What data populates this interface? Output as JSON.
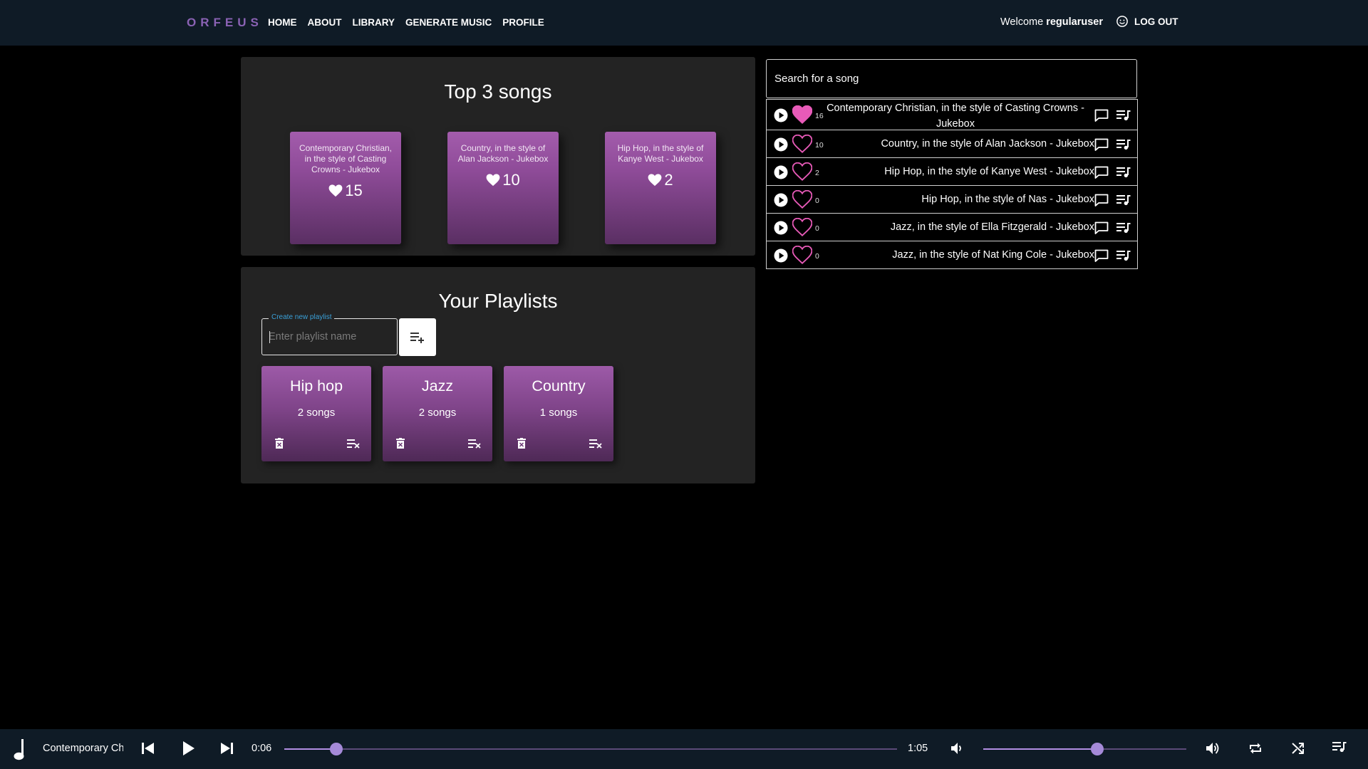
{
  "nav": {
    "brand": "ORFEUS",
    "links": [
      "HOME",
      "ABOUT",
      "LIBRARY",
      "GENERATE MUSIC",
      "PROFILE"
    ],
    "welcome_prefix": "Welcome",
    "username": "regularuser",
    "logout_label": "LOG OUT"
  },
  "top_songs": {
    "title": "Top 3 songs",
    "cards": [
      {
        "title": "Contemporary Christian, in the style of Casting Crowns - Jukebox",
        "likes": "15"
      },
      {
        "title": "Country, in the style of Alan Jackson - Jukebox",
        "likes": "10"
      },
      {
        "title": "Hip Hop, in the style of Kanye West - Jukebox",
        "likes": "2"
      }
    ]
  },
  "playlists": {
    "title": "Your Playlists",
    "new_label": "Create new playlist",
    "new_placeholder": "Enter playlist name",
    "items": [
      {
        "name": "Hip hop",
        "count": "2 songs"
      },
      {
        "name": "Jazz",
        "count": "2 songs"
      },
      {
        "name": "Country",
        "count": "1 songs"
      }
    ]
  },
  "search": {
    "placeholder": "Search for a song"
  },
  "songs": [
    {
      "title": "Contemporary Christian, in the style of Casting Crowns - Jukebox",
      "likes": "16",
      "liked": true
    },
    {
      "title": "Country, in the style of Alan Jackson - Jukebox",
      "likes": "10",
      "liked": false
    },
    {
      "title": "Hip Hop, in the style of Kanye West - Jukebox",
      "likes": "2",
      "liked": false
    },
    {
      "title": "Hip Hop, in the style of Nas - Jukebox",
      "likes": "0",
      "liked": false
    },
    {
      "title": "Jazz, in the style of Ella Fitzgerald - Jukebox",
      "likes": "0",
      "liked": false
    },
    {
      "title": "Jazz, in the style of Nat King Cole - Jukebox",
      "likes": "0",
      "liked": false
    }
  ],
  "player": {
    "now_playing": "Contemporary Christian, in the style of Casting Crowns - Jukebox",
    "current_time": "0:06",
    "total_time": "1:05",
    "progress": 0.085,
    "volume": 0.56
  },
  "colors": {
    "brand": "#8a62b4",
    "accent": "#a58ad8",
    "liked": "#e85ab8",
    "bar": "#0f1b26",
    "panel": "#232323"
  }
}
